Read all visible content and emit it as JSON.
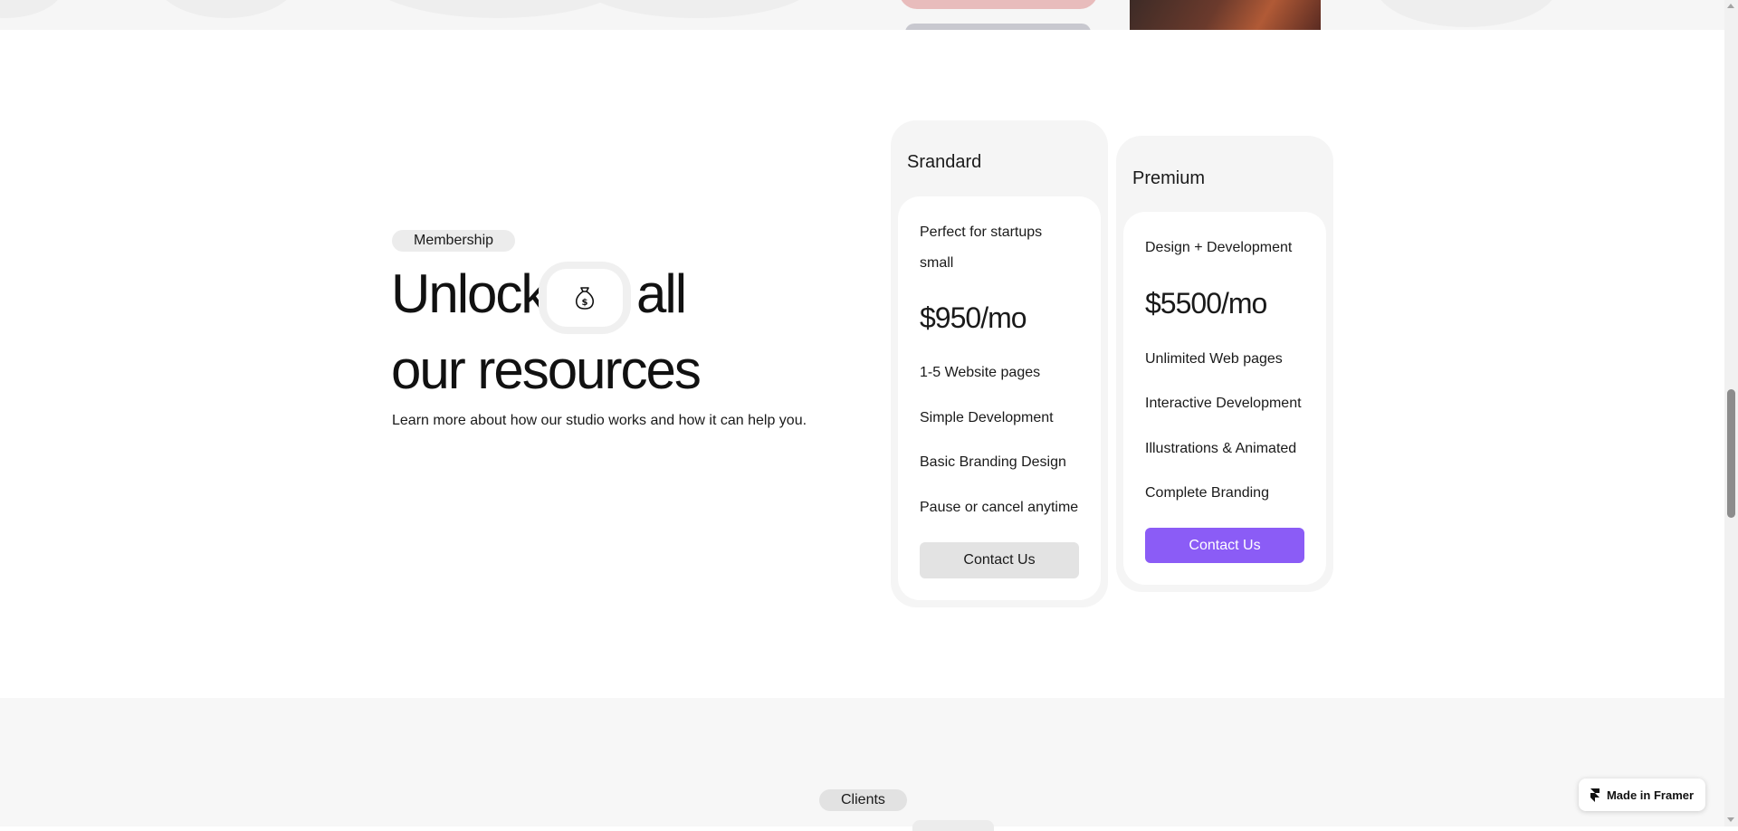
{
  "membership": {
    "badge": "Membership",
    "headline_part1": "Unlock",
    "headline_part2": "all",
    "headline_line2": "our resources",
    "headline_icon": "money-bag-icon",
    "subtitle": "Learn more about how our studio works and how it can help you."
  },
  "plans": [
    {
      "name": "Srandard",
      "description": "Perfect for startups small",
      "price": "$950/mo",
      "features": [
        "1-5 Website pages",
        "Simple Development",
        "Basic Branding Design",
        "Pause or cancel anytime"
      ],
      "cta": "Contact Us"
    },
    {
      "name": "Premium",
      "description": "Design + Development",
      "price": "$5500/mo",
      "features": [
        "Unlimited Web pages",
        "Interactive Development",
        "Illustrations & Animated",
        "Complete Branding"
      ],
      "cta": "Contact Us"
    }
  ],
  "clients": {
    "badge": "Clients"
  },
  "framer_badge": {
    "label": "Made in Framer",
    "icon": "framer-logo-icon"
  },
  "colors": {
    "accent": "#8b5cf6",
    "card_bg": "#f5f5f5",
    "badge_bg": "#ececec"
  }
}
